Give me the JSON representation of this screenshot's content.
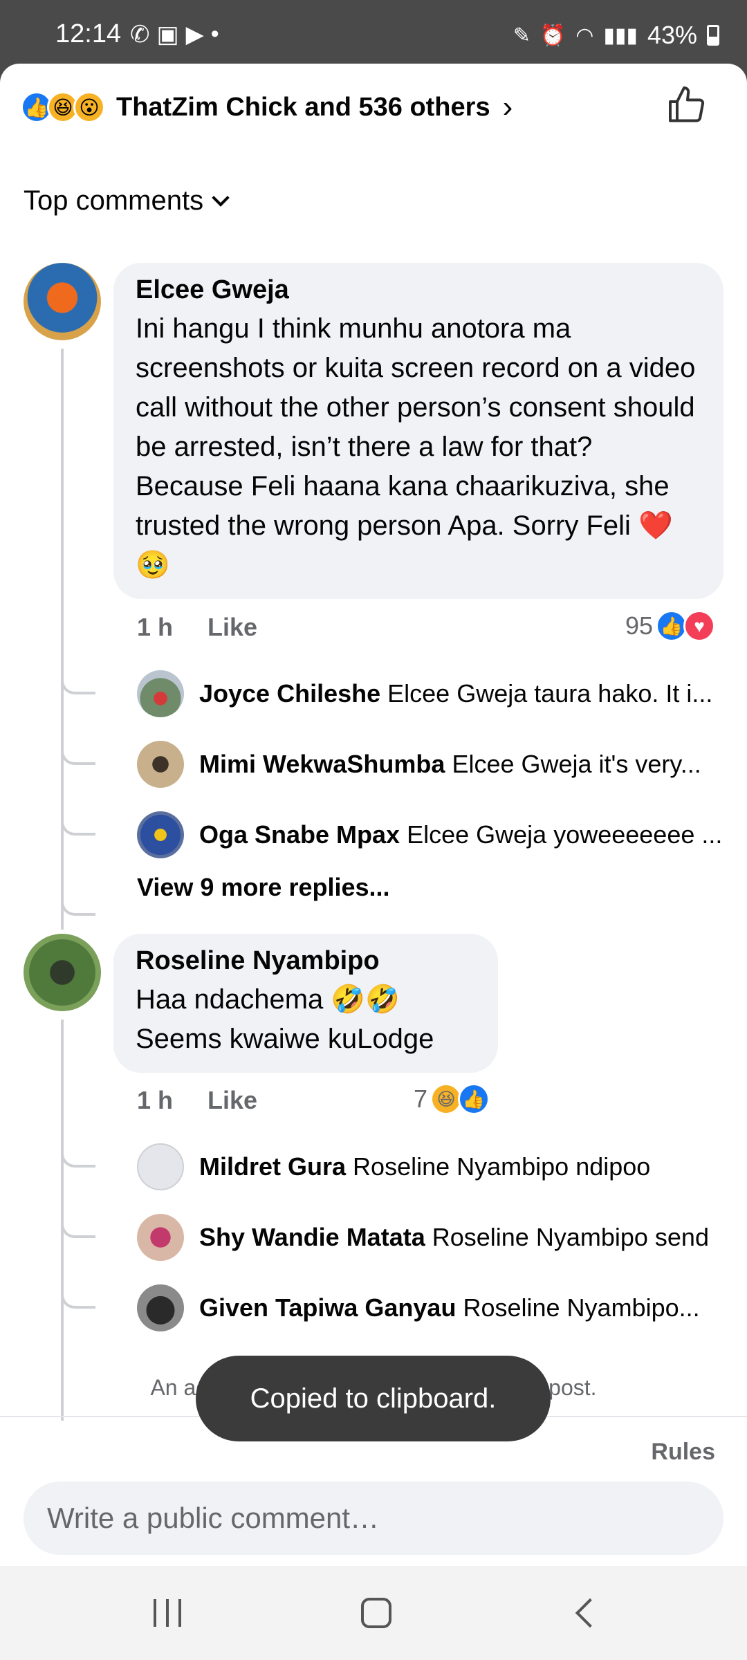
{
  "status_bar": {
    "time": "12:14",
    "battery": "43%"
  },
  "header": {
    "reactors": "ThatZim Chick and 536 others"
  },
  "sort": {
    "label": "Top comments"
  },
  "comments": [
    {
      "author": "Elcee Gweja",
      "text": "Ini hangu I think munhu anotora ma screenshots or kuita screen record on a video call without the other person’s consent should be arrested, isn’t there a law for that? Because Feli haana kana chaarikuziva, she trusted the wrong person Apa. Sorry Feli ❤️🥹",
      "time": "1 h",
      "like_label": "Like",
      "reaction_count": "95",
      "replies": [
        {
          "name": "Joyce Chileshe",
          "text": "Elcee Gweja taura hako. It i..."
        },
        {
          "name": "Mimi WekwaShumba",
          "text": "Elcee Gweja it's very..."
        },
        {
          "name": "Oga Snabe Mpax",
          "text": "Elcee Gweja yoweeeeeee ..."
        }
      ],
      "view_more": "View 9 more replies..."
    },
    {
      "author": "Roseline Nyambipo",
      "text": "Haa ndachema 🤣🤣\nSeems kwaiwe kuLodge",
      "time": "1 h",
      "like_label": "Like",
      "reaction_count": "7",
      "replies": [
        {
          "name": "Mildret Gura",
          "text": "Roseline Nyambipo ndipoo"
        },
        {
          "name": "Shy Wandie Matata",
          "text": "Roseline Nyambipo send"
        },
        {
          "name": "Given Tapiwa Ganyau",
          "text": "Roseline Nyambipo..."
        }
      ]
    }
  ],
  "footer": {
    "closed_note": "An admin turned off commenting for this post.",
    "rules": "Rules",
    "composer_placeholder": "Write a public comment…"
  },
  "toast": "Copied to clipboard.",
  "colors": {
    "facebook_blue": "#1877f2",
    "bubble_bg": "#f0f2f5",
    "love_red": "#f33e58",
    "haha_yellow": "#f7b125"
  }
}
